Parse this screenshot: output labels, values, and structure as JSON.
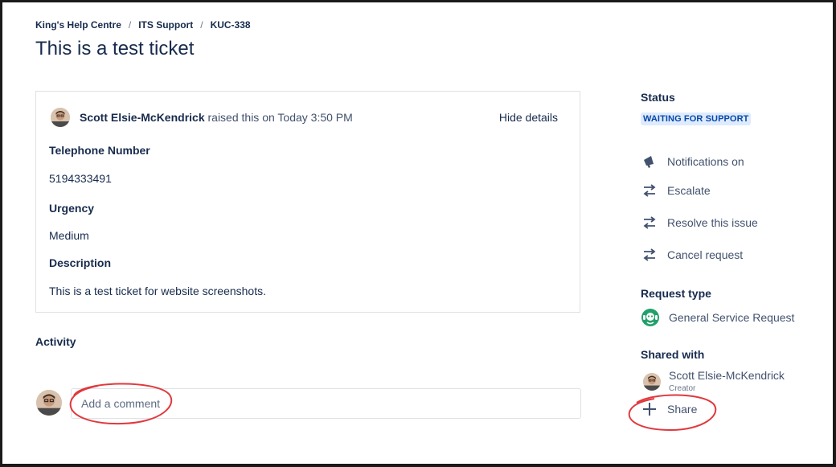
{
  "breadcrumb": {
    "items": [
      "King's Help Centre",
      "ITS Support",
      "KUC-338"
    ],
    "separator": "/"
  },
  "page_title": "This is a test ticket",
  "request": {
    "reporter_name": "Scott Elsie-McKendrick",
    "raised_text": "raised this on Today 3:50 PM",
    "hide_details_label": "Hide details",
    "fields": [
      {
        "label": "Telephone Number",
        "value": "5194333491"
      },
      {
        "label": "Urgency",
        "value": "Medium"
      },
      {
        "label": "Description",
        "value": "This is a test ticket for website screenshots."
      }
    ]
  },
  "activity": {
    "title": "Activity",
    "comment_placeholder": "Add a comment"
  },
  "sidebar": {
    "status_heading": "Status",
    "status_value": "WAITING FOR SUPPORT",
    "actions": [
      {
        "label": "Notifications on",
        "icon": "megaphone-icon"
      },
      {
        "label": "Escalate",
        "icon": "transition-icon"
      },
      {
        "label": "Resolve this issue",
        "icon": "transition-icon"
      },
      {
        "label": "Cancel request",
        "icon": "transition-icon"
      }
    ],
    "request_type_heading": "Request type",
    "request_type_value": "General Service Request",
    "shared_with_heading": "Shared with",
    "shared_person_name": "Scott Elsie-McKendrick",
    "shared_person_role": "Creator",
    "share_label": "Share"
  },
  "colors": {
    "text": "#172b4d",
    "muted": "#42526e",
    "border": "#dfe1e6",
    "status_bg": "#deebff",
    "status_text": "#0747a6",
    "annotation_red": "#e0393e",
    "request_type_icon": "#22a06b"
  }
}
